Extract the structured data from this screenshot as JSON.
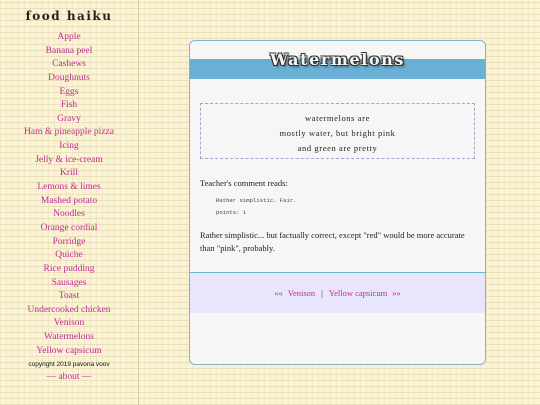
{
  "site": {
    "title": "food haiku",
    "nav": [
      "Apple",
      "Banana peel",
      "Cashews",
      "Doughnuts",
      "Eggs",
      "Fish",
      "Gravy",
      "Ham & pineapple pizza",
      "Icing",
      "Jelly & ice-cream",
      "Krill",
      "Lemons & limes",
      "Mashed potato",
      "Noodles",
      "Orange cordial",
      "Porridge",
      "Quiche",
      "Rice pudding",
      "Sausages",
      "Toast",
      "Undercooked chicken",
      "Venison",
      "Watermelons",
      "Yellow capsicum"
    ],
    "copyright": "copyright 2019 pavona voov",
    "about": "— about —"
  },
  "page": {
    "title": "Watermelons",
    "poem": [
      "watermelons are",
      "mostly water, but bright pink",
      "and green are pretty"
    ],
    "comment_label": "Teacher's comment reads:",
    "comment_text": "Rather simplistic. Fair.",
    "comment_points": "points: 1",
    "remark": "Rather simplistic... but factually correct, except \"red\" would be more accurate than \"pink\", probably.",
    "prev_arrow": "««",
    "prev": "Venison",
    "separator": "|",
    "next": "Yellow capsicum",
    "next_arrow": "»»"
  }
}
